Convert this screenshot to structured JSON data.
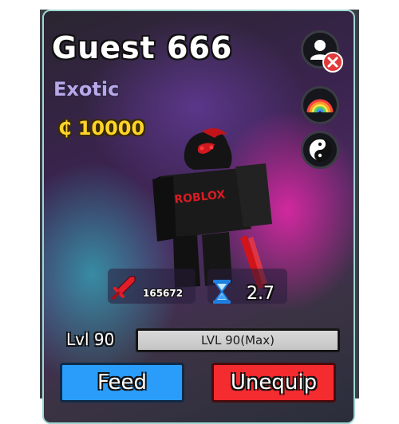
{
  "pet": {
    "name": "Guest 666",
    "rarity": "Exotic",
    "value_currency": "₵",
    "value": "10000",
    "power": "165672",
    "cooldown": "2.7",
    "level_label": "Lvl 90",
    "level_bar_text": "LVL 90(Max)",
    "level_progress": 1.0,
    "shirt_text": "ROBLOX"
  },
  "actions": {
    "feed_label": "Feed",
    "unequip_label": "Unequip"
  },
  "side_buttons": [
    {
      "icon": "unequip-user-icon"
    },
    {
      "icon": "rainbow-icon"
    },
    {
      "icon": "yin-yang-icon"
    }
  ],
  "colors": {
    "feed_button": "#2a9dfb",
    "unequip_button": "#f42b2f",
    "value_text": "#ffd42a",
    "rarity_text": "#b9a8e8",
    "card_border": "#9fd8d2"
  }
}
